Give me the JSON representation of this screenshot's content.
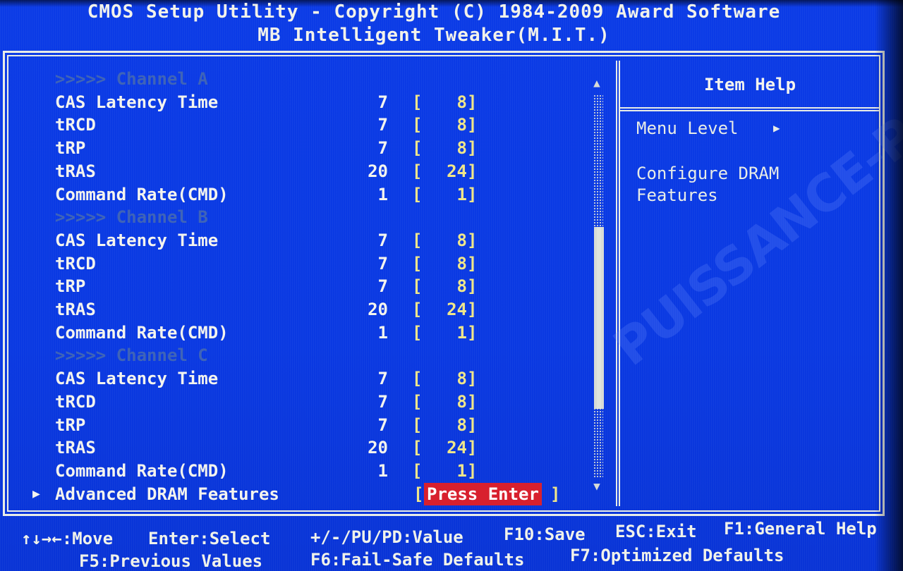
{
  "header": {
    "title_line1": "CMOS Setup Utility - Copyright (C) 1984-2009 Award Software",
    "title_line2": "MB Intelligent Tweaker(M.I.T.)"
  },
  "menu": {
    "rows": [
      {
        "type": "channel",
        "label": ">>>>> Channel A"
      },
      {
        "type": "setting",
        "label": "CAS Latency Time",
        "current": "7",
        "value": "8"
      },
      {
        "type": "setting",
        "label": "tRCD",
        "current": "7",
        "value": "8"
      },
      {
        "type": "setting",
        "label": "tRP",
        "current": "7",
        "value": "8"
      },
      {
        "type": "setting",
        "label": "tRAS",
        "current": "20",
        "value": "24"
      },
      {
        "type": "setting",
        "label": "Command Rate(CMD)",
        "current": "1",
        "value": "1"
      },
      {
        "type": "channel",
        "label": ">>>>> Channel B"
      },
      {
        "type": "setting",
        "label": "CAS Latency Time",
        "current": "7",
        "value": "8"
      },
      {
        "type": "setting",
        "label": "tRCD",
        "current": "7",
        "value": "8"
      },
      {
        "type": "setting",
        "label": "tRP",
        "current": "7",
        "value": "8"
      },
      {
        "type": "setting",
        "label": "tRAS",
        "current": "20",
        "value": "24"
      },
      {
        "type": "setting",
        "label": "Command Rate(CMD)",
        "current": "1",
        "value": "1"
      },
      {
        "type": "channel",
        "label": ">>>>> Channel C"
      },
      {
        "type": "setting",
        "label": "CAS Latency Time",
        "current": "7",
        "value": "8"
      },
      {
        "type": "setting",
        "label": "tRCD",
        "current": "7",
        "value": "8"
      },
      {
        "type": "setting",
        "label": "tRP",
        "current": "7",
        "value": "8"
      },
      {
        "type": "setting",
        "label": "tRAS",
        "current": "20",
        "value": "24"
      },
      {
        "type": "setting",
        "label": "Command Rate(CMD)",
        "current": "1",
        "value": "1"
      },
      {
        "type": "submenu",
        "label": "Advanced DRAM Features",
        "value": "Press Enter",
        "selected": true
      }
    ],
    "bracket_open": "[",
    "bracket_close": "]",
    "submenu_arrow": "▶",
    "scroll_up": "▲",
    "scroll_down": "▼"
  },
  "help": {
    "title": "Item Help",
    "menu_level_label": "Menu Level",
    "menu_level_arrow": "▶",
    "description_line1": "Configure DRAM",
    "description_line2": "Features"
  },
  "watermark": "PUISSANCE-PC",
  "footer": {
    "move": "↑↓→←:Move",
    "select": "Enter:Select",
    "value": "+/-/PU/PD:Value",
    "save": "F10:Save",
    "exit": "ESC:Exit",
    "general_help": "F1:General Help",
    "previous": "F5:Previous Values",
    "failsafe": "F6:Fail-Safe Defaults",
    "optimized": "F7:Optimized Defaults"
  },
  "colors": {
    "background": "#0a3ae0",
    "text": "#f4f4ee",
    "value_text": "#f0e68a",
    "channel_text": "#3f64b8",
    "selection": "#d8202e"
  }
}
